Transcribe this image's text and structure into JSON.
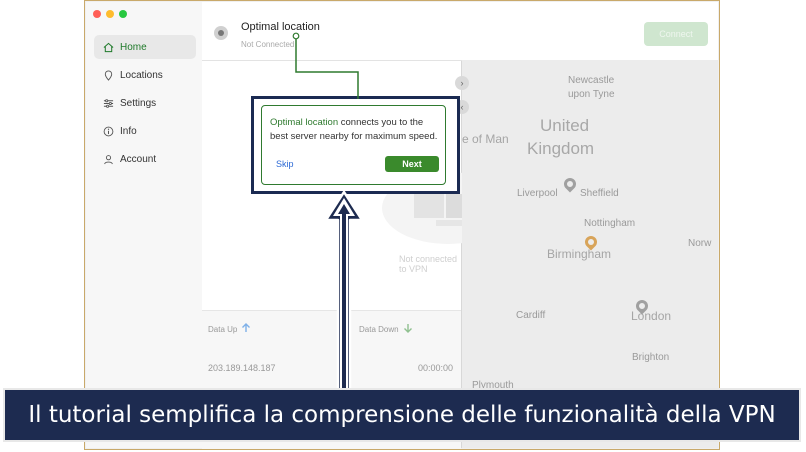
{
  "window": {
    "traffic_colors": [
      "#ff5f57",
      "#febc2e",
      "#28c840"
    ]
  },
  "sidebar": {
    "items": [
      {
        "label": "Home",
        "icon": "home-icon",
        "active": true
      },
      {
        "label": "Locations",
        "icon": "location-pin-icon"
      },
      {
        "label": "Settings",
        "icon": "sliders-icon"
      },
      {
        "label": "Info",
        "icon": "info-icon"
      },
      {
        "label": "Account",
        "icon": "user-icon"
      }
    ]
  },
  "header": {
    "location_title": "Optimal location",
    "status": "Not Connected",
    "connect_label": "Connect"
  },
  "main": {
    "not_connected_text": "Not connected to VPN"
  },
  "stats": {
    "data_up_label": "Data Up",
    "data_down_label": "Data Down",
    "ip": "203.189.148.187",
    "time": "00:00:00"
  },
  "tooltip": {
    "highlight": "Optimal location",
    "text": " connects you to the best server nearby for maximum speed.",
    "skip_label": "Skip",
    "next_label": "Next"
  },
  "map": {
    "labels": {
      "newcastle": "Newcastle",
      "upon_tyne": "upon Tyne",
      "isle_of_man": "e of Man",
      "united": "United",
      "kingdom": "Kingdom",
      "liverpool": "Liverpool",
      "sheffield": "Sheffield",
      "nottingham": "Nottingham",
      "birmingham": "Birmingham",
      "norw": "Norw",
      "cardiff": "Cardiff",
      "london": "London",
      "brighton": "Brighton",
      "plymouth": "Plymouth"
    },
    "pin_color": "#a0a0a0",
    "active_pin_color": "#d8a45a"
  },
  "accent": "#3a8a2c",
  "annotation": {
    "caption": "Il tutorial semplifica la comprensione delle funzionalità della VPN",
    "color": "#1d2b50"
  }
}
